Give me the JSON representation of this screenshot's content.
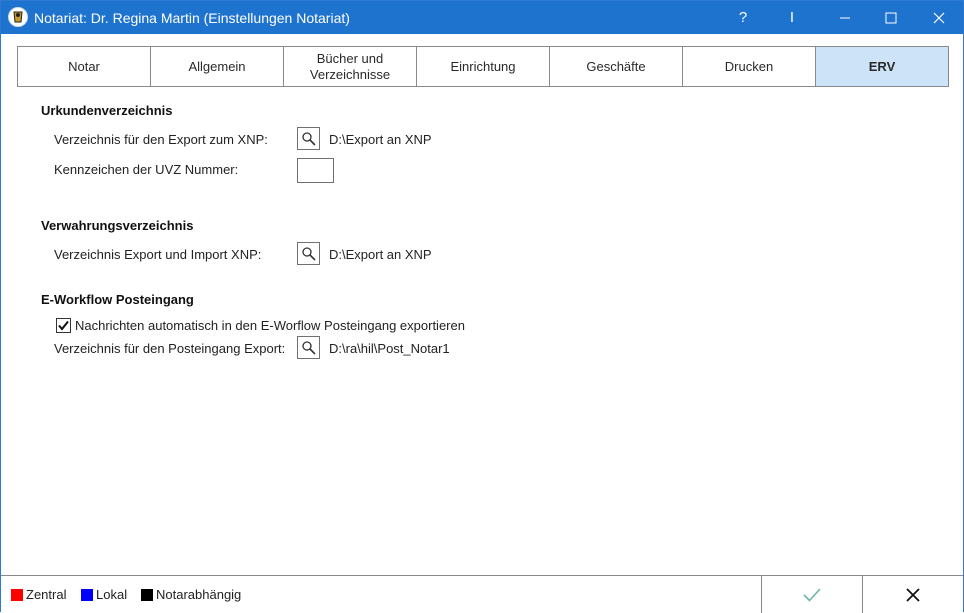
{
  "window": {
    "title": "Notariat: Dr. Regina Martin (Einstellungen Notariat)",
    "controls": {
      "help": "?",
      "info": "I"
    }
  },
  "tabs": [
    {
      "label": "Notar",
      "active": false
    },
    {
      "label": "Allgemein",
      "active": false
    },
    {
      "label": "Bücher und\nVerzeichnisse",
      "active": false
    },
    {
      "label": "Einrichtung",
      "active": false
    },
    {
      "label": "Geschäfte",
      "active": false
    },
    {
      "label": "Drucken",
      "active": false
    },
    {
      "label": "ERV",
      "active": true
    }
  ],
  "urkunden": {
    "title": "Urkundenverzeichnis",
    "export_label": "Verzeichnis für den Export zum XNP:",
    "export_path": "D:\\Export an XNP",
    "uvz_label": "Kennzeichen der UVZ Nummer:",
    "uvz_value": ""
  },
  "verwahrung": {
    "title": "Verwahrungsverzeichnis",
    "export_label": "Verzeichnis Export und Import XNP:",
    "export_path": "D:\\Export an XNP"
  },
  "eworkflow": {
    "title": "E-Workflow Posteingang",
    "checkbox_label": "Nachrichten automatisch in den E-Worflow Posteingang exportieren",
    "checkbox_checked": true,
    "export_label": "Verzeichnis für den Posteingang Export:",
    "export_path": "D:\\ra\\hil\\Post_Notar1"
  },
  "legend": [
    {
      "label": "Zentral",
      "color": "#ff0000"
    },
    {
      "label": "Lokal",
      "color": "#0000ff"
    },
    {
      "label": "Notarabhängig",
      "color": "#000000"
    }
  ],
  "colors": {
    "titlebar": "#1e73cf",
    "active_tab": "#cde3f7",
    "ok_check": "#6fb3a8"
  }
}
